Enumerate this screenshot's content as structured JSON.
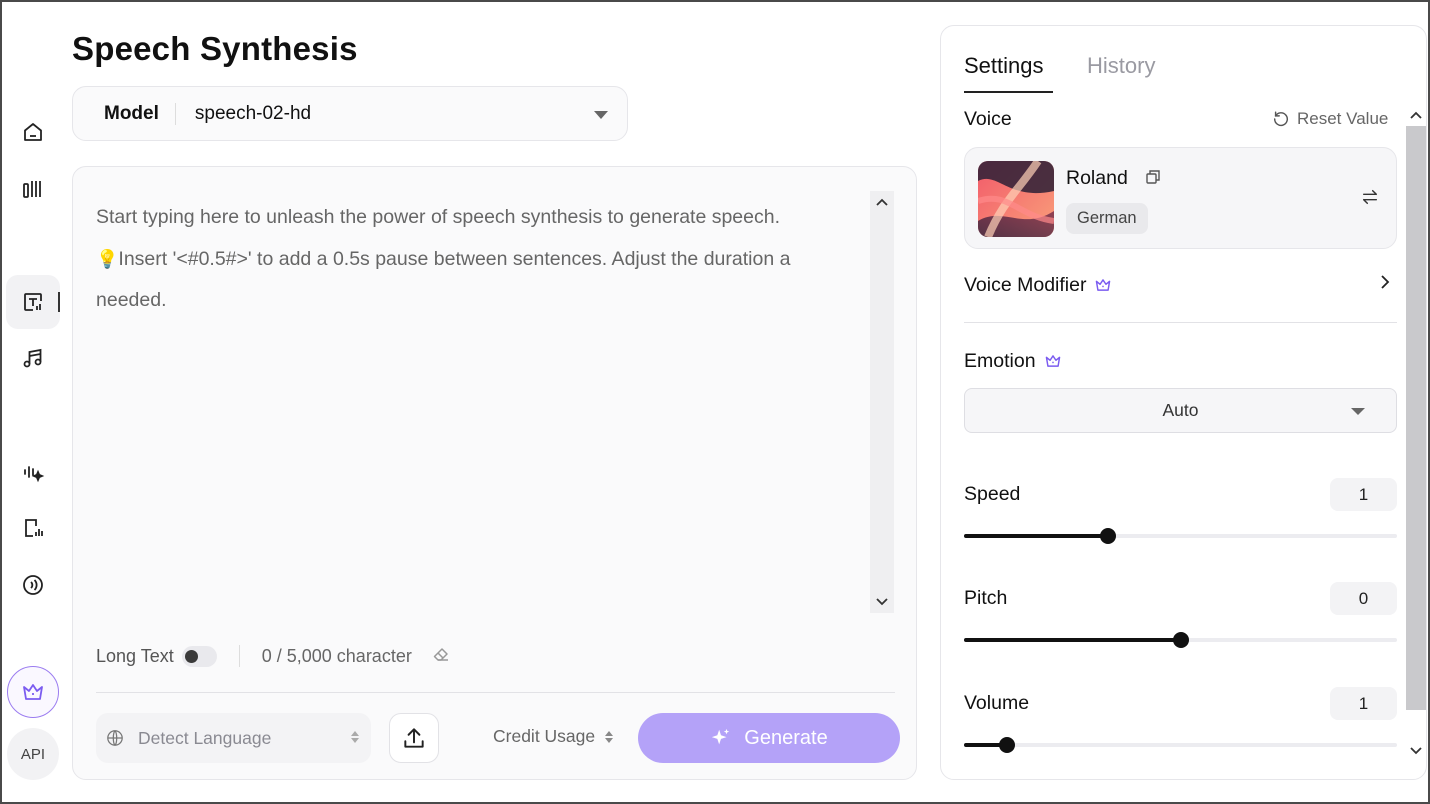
{
  "page": {
    "title": "Speech Synthesis"
  },
  "sidebar": {
    "items": [
      {
        "icon": "home-icon"
      },
      {
        "icon": "library-icon"
      },
      {
        "icon": "text-to-speech-icon",
        "active": true
      },
      {
        "icon": "music-icon"
      },
      {
        "icon": "voice-design-icon"
      },
      {
        "icon": "voice-clone-icon"
      },
      {
        "icon": "audio-wave-icon"
      }
    ],
    "premium_icon": "crown-icon",
    "api_label": "API"
  },
  "model": {
    "label": "Model",
    "value": "speech-02-hd"
  },
  "editor": {
    "placeholder_line1": "Start typing here to unleash the power of speech synthesis to generate speech.",
    "placeholder_line2": "Insert '<#0.5#>' to add a 0.5s pause between sentences. Adjust the duration a",
    "placeholder_line3": "needed.",
    "long_text_label": "Long Text",
    "long_text_enabled": false,
    "char_count": "0 / 5,000 character"
  },
  "footer": {
    "language_placeholder": "Detect Language",
    "credit_label": "Credit Usage",
    "generate_label": "Generate",
    "accent_color": "#b4a2f8"
  },
  "panel": {
    "tabs": {
      "settings": "Settings",
      "history": "History",
      "active": "Settings"
    },
    "voice": {
      "label": "Voice",
      "reset_label": "Reset Value",
      "name": "Roland",
      "tag": "German"
    },
    "voice_modifier_label": "Voice Modifier",
    "emotion": {
      "label": "Emotion",
      "value": "Auto"
    },
    "speed": {
      "label": "Speed",
      "value": "1",
      "fraction": 0.333
    },
    "pitch": {
      "label": "Pitch",
      "value": "0",
      "fraction": 0.5
    },
    "volume": {
      "label": "Volume",
      "value": "1",
      "fraction": 0.1
    }
  }
}
